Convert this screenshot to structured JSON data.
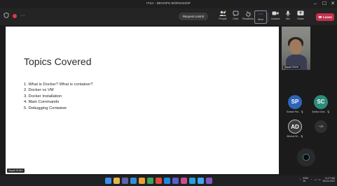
{
  "window": {
    "title": "ITSA - DEVOPS WORKSHOP",
    "controls": [
      "–",
      "☐",
      "✕"
    ]
  },
  "toolbar": {
    "request_control": "Request control",
    "buttons": [
      {
        "icon": "people-icon",
        "label": "People"
      },
      {
        "icon": "chat-icon",
        "label": "Chat"
      },
      {
        "icon": "reactions-icon",
        "label": "Reactions"
      },
      {
        "icon": "more-icon",
        "label": "More"
      },
      {
        "icon": "camera-icon",
        "label": "Camera"
      },
      {
        "icon": "mic-icon",
        "label": "Mic"
      },
      {
        "icon": "share-icon",
        "label": "Share"
      }
    ],
    "leave_label": "Leave"
  },
  "slide": {
    "title": "Topics Covered",
    "topics": [
      "1.  What is Docker? What is container?",
      "2.  Docker vs VM",
      "3.  Docker Installation",
      "4.  Main Commands",
      "5.  Debugging Container"
    ],
    "presenter_tag": "Sayali SHAH"
  },
  "participants": {
    "video_name": "Sayali SHAH",
    "tiles": [
      {
        "initials": "SP",
        "name": "Sumant Pat...",
        "color": "#2f64b8"
      },
      {
        "initials": "SC",
        "name": "Sanika Chav...",
        "color": "#2e8b7a"
      },
      {
        "initials": "AD",
        "name": "Atharva Dh...",
        "color": "#3a3a3a"
      }
    ],
    "more_label": "+28"
  },
  "taskbar": {
    "lang": "ENG",
    "region": "IN",
    "time": "11:27 AM",
    "date": "08-04-2022"
  }
}
